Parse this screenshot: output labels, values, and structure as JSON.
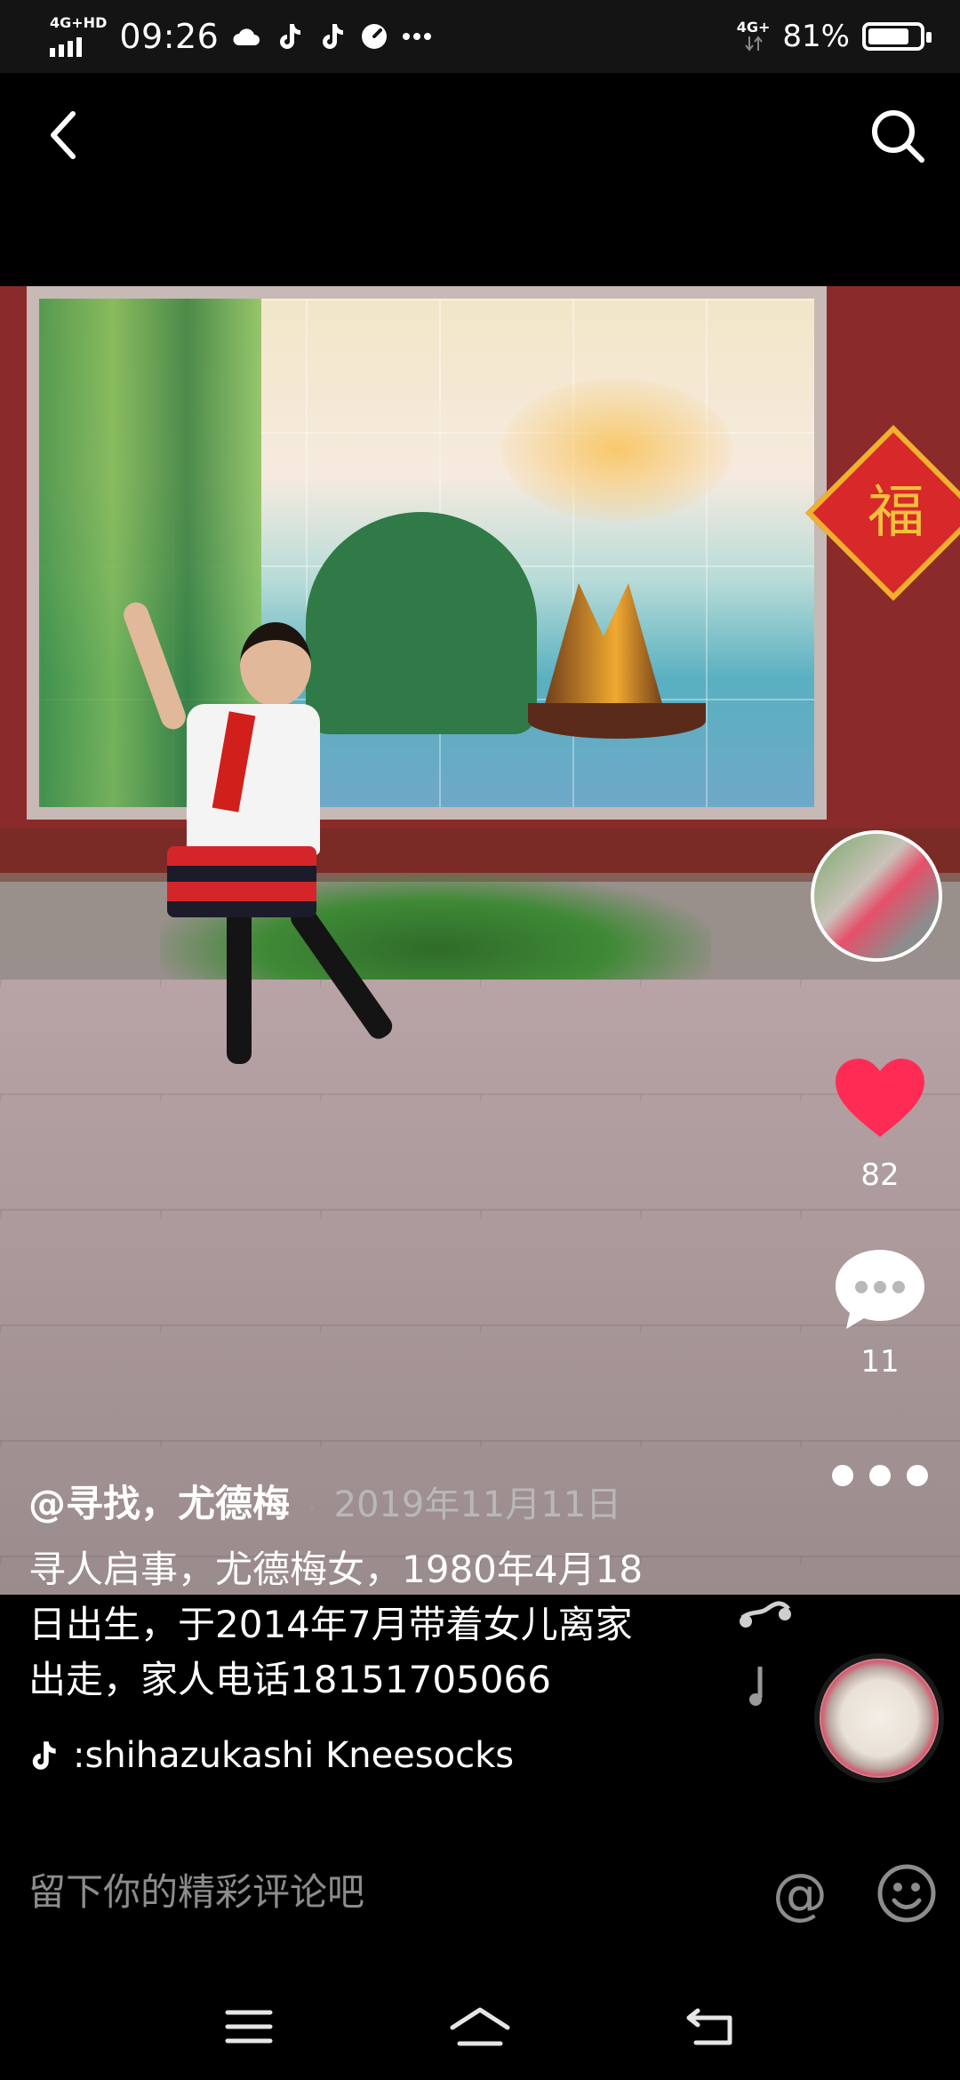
{
  "status_bar": {
    "network_left": "4G+HD",
    "time": "09:26",
    "network_right": "4G+",
    "battery_percent": "81%",
    "battery_level": 0.81,
    "icons": [
      "cloud-icon",
      "tiktok-icon",
      "tiktok-icon",
      "speed-icon",
      "more-dots-icon"
    ]
  },
  "nav": {
    "back_icon": "chevron-left-icon",
    "search_icon": "search-icon"
  },
  "actions": {
    "like_count": "82",
    "comment_count": "11",
    "like_color": "#fe2c55"
  },
  "post": {
    "username": "@寻找，尤德梅",
    "separator": "·",
    "date": "2019年11月11日",
    "description_lines": [
      "寻人启事，尤德梅女，1980年4月18",
      "日出生，于2014年7月带着女儿离家",
      "出走，家人电话18151705066"
    ],
    "music_title": ":shihazukashi Kneesocks",
    "fu_character": "福"
  },
  "comment_bar": {
    "placeholder": "留下你的精彩评论吧",
    "at_label": "@"
  }
}
